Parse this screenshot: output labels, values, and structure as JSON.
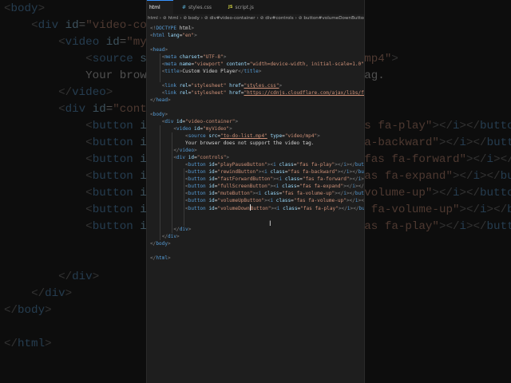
{
  "tabs": [
    {
      "label": "html",
      "modified": true
    },
    {
      "label": "styles.css",
      "icon": "#"
    },
    {
      "label": "script.js",
      "icon": "JS"
    }
  ],
  "breadcrumb": [
    "html",
    "html",
    "body",
    "div#video-container",
    "div#controls",
    "button#volumeDownButton"
  ],
  "code_lines": [
    "<!DOCTYPE html>",
    "<html lang=\"en\">",
    "",
    "<head>",
    "    <meta charset=\"UTF-8\">",
    "    <meta name=\"viewport\" content=\"width=device-width, initial-scale=1.0\">",
    "    <title>Custom Video Player</title>",
    "",
    "    <link rel=\"stylesheet\" href=\"styles.css\">",
    "    <link rel=\"stylesheet\" href=\"https://cdnjs.cloudflare.com/ajax/libs/font-awesome\">",
    "</head>",
    "",
    "<body>",
    "    <div id=\"video-container\">",
    "        <video id=\"myVideo\">",
    "            <source src=\"to-do-list.mp4\" type=\"video/mp4\">",
    "            Your browser does not support the video tag.",
    "        </video>",
    "        <div id=\"controls\">",
    "            <button id=\"playPauseButton\"><i class=\"fas fa-play\"></i></button>",
    "            <button id=\"rewindButton\"><i class=\"fas fa-backward\"></i></button>",
    "            <button id=\"fastForwardButton\"><i class=\"fas fa-forward\"></i></button>",
    "            <button id=\"fullScreenButton\"><i class=\"fas fa-expand\"></i></button>",
    "            <button id=\"muteButton\"><i class=\"fas fa-volume-up\"></i></button>",
    "            <button id=\"volumeUpButton\"><i class=\"fas fa-volume-up\"></i></button>",
    "            <button id=\"volumeDownButton\"><i class=\"fas fa-play\"></i></button>",
    "",
    "",
    "        </div>",
    "    </div>",
    "</body>",
    "",
    "</html>"
  ],
  "colors": {
    "tag": "#569cd6",
    "attr": "#9cdcfe",
    "string": "#ce9178",
    "text": "#d4d4d4"
  }
}
